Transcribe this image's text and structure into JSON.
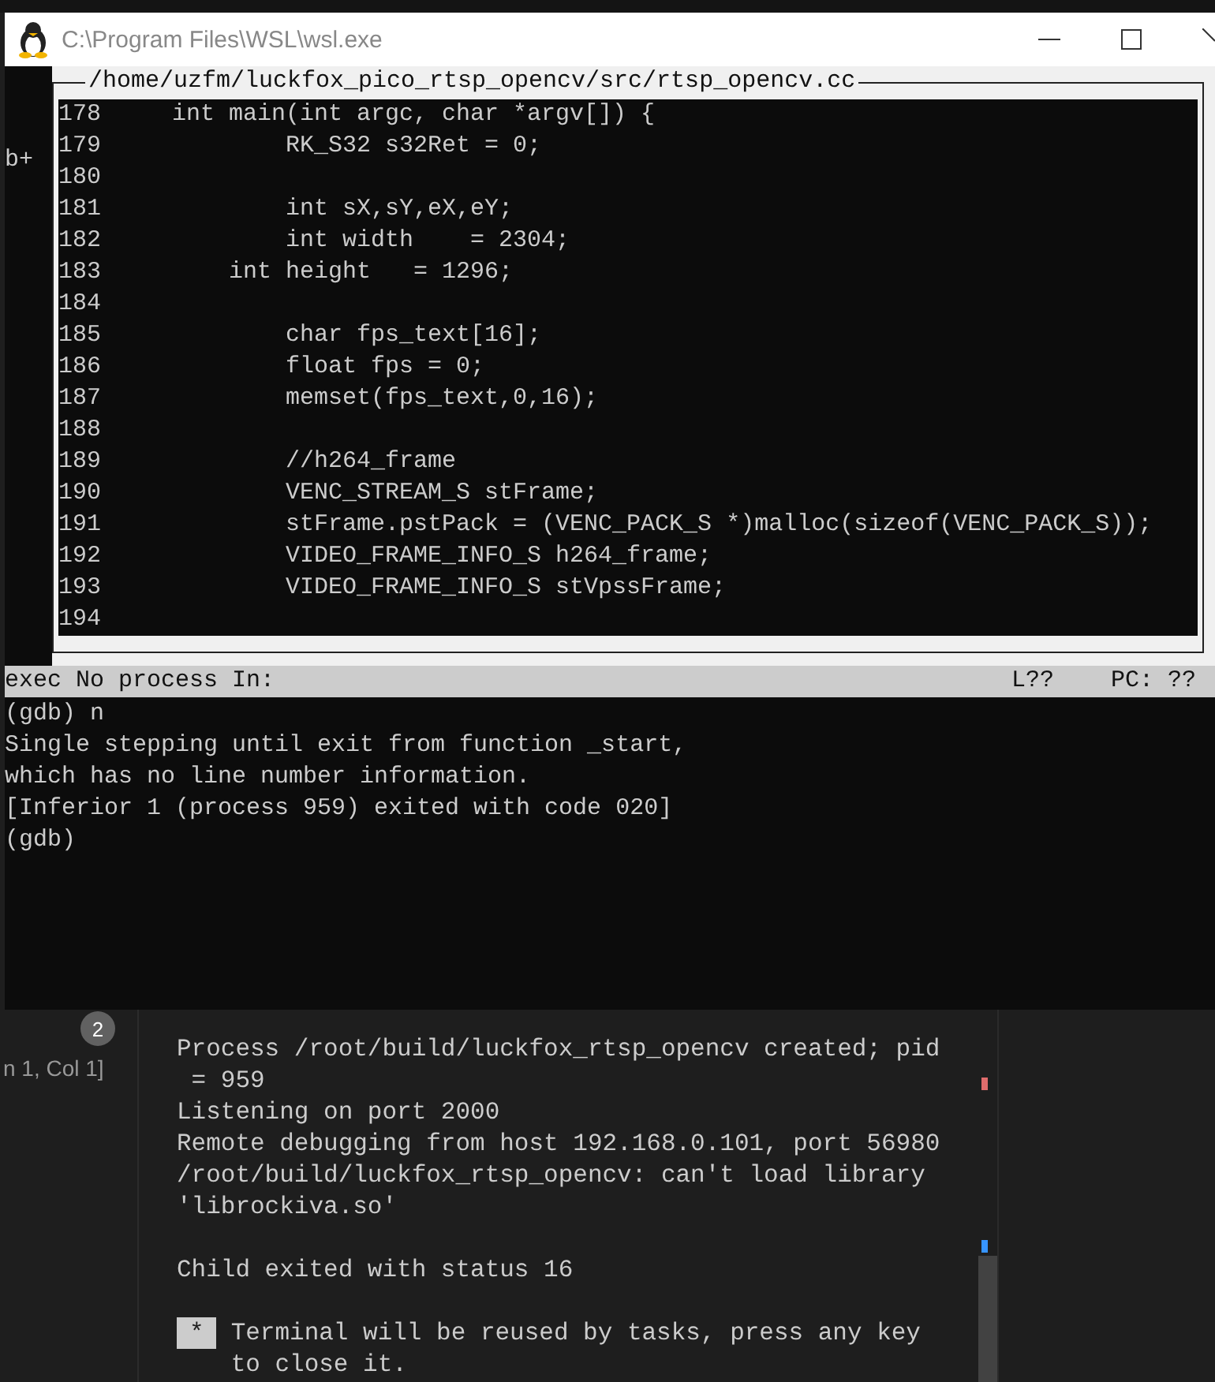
{
  "window": {
    "title": "C:\\Program Files\\WSL\\wsl.exe"
  },
  "source": {
    "title": "/home/uzfm/luckfox_pico_rtsp_opencv/src/rtsp_opencv.cc",
    "lines": [
      {
        "number": "178",
        "code": "    int main(int argc, char *argv[]) {"
      },
      {
        "number": "179",
        "code": "            RK_S32 s32Ret = 0;",
        "marker": "b+"
      },
      {
        "number": "180"
      },
      {
        "number": "181",
        "code": "            int sX,sY,eX,eY;"
      },
      {
        "number": "182",
        "code": "            int width    = 2304;"
      },
      {
        "number": "183",
        "code": "        int height   = 1296;"
      },
      {
        "number": "184"
      },
      {
        "number": "185",
        "code": "            char fps_text[16];"
      },
      {
        "number": "186",
        "code": "            float fps = 0;"
      },
      {
        "number": "187",
        "code": "            memset(fps_text,0,16);"
      },
      {
        "number": "188"
      },
      {
        "number": "189",
        "code": "            //h264_frame"
      },
      {
        "number": "190",
        "code": "            VENC_STREAM_S stFrame;"
      },
      {
        "number": "191",
        "code": "            stFrame.pstPack = (VENC_PACK_S *)malloc(sizeof(VENC_PACK_S));"
      },
      {
        "number": "192",
        "code": "            VIDEO_FRAME_INFO_S h264_frame;"
      },
      {
        "number": "193",
        "code": "            VIDEO_FRAME_INFO_S stVpssFrame;"
      },
      {
        "number": "194"
      }
    ]
  },
  "status_line": {
    "left": "exec No process In:",
    "line": "L??",
    "pc": "PC: ??"
  },
  "console": [
    "(gdb) n",
    "Single stepping until exit from function _start,",
    "which has no line number information.",
    "[Inferior 1 (process 959) exited with code 020]",
    "(gdb)"
  ],
  "editor": {
    "badge": "2",
    "position": "n 1, Col 1]"
  },
  "terminal": {
    "paragraphs": [
      [
        "Process /root/build/luckfox_rtsp_opencv created; pid",
        " = 959",
        "Listening on port 2000",
        "Remote debugging from host 192.168.0.101, port 56980",
        "/root/build/luckfox_rtsp_opencv: can't load library",
        "'librockiva.so'"
      ],
      [
        "Child exited with status 16"
      ]
    ],
    "notice": {
      "key": "*",
      "text": "Terminal will be reused by tasks, press any key to close it."
    }
  }
}
